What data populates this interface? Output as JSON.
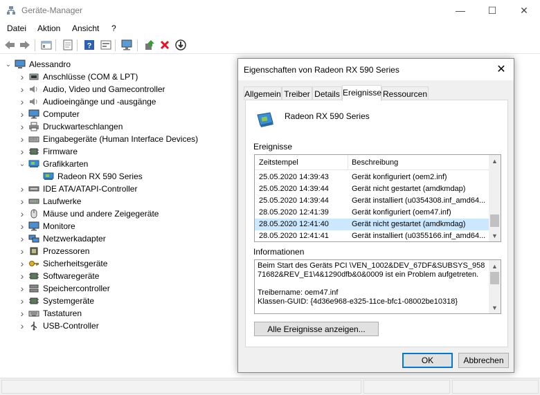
{
  "window": {
    "title": "Geräte-Manager",
    "minimize": "—",
    "maximize": "☐",
    "close": "✕"
  },
  "menu": [
    "Datei",
    "Aktion",
    "Ansicht",
    "?"
  ],
  "tree": {
    "root": "Alessandro",
    "items": [
      {
        "label": "Anschlüsse (COM & LPT)",
        "icon": "port-icon"
      },
      {
        "label": "Audio, Video und Gamecontroller",
        "icon": "speaker-icon"
      },
      {
        "label": "Audioeingänge und -ausgänge",
        "icon": "speaker-icon"
      },
      {
        "label": "Computer",
        "icon": "monitor-icon"
      },
      {
        "label": "Druckwarteschlangen",
        "icon": "printer-icon"
      },
      {
        "label": "Eingabegeräte (Human Interface Devices)",
        "icon": "hid-icon"
      },
      {
        "label": "Firmware",
        "icon": "chip-icon"
      },
      {
        "label": "Grafikkarten",
        "icon": "display-adapter-icon",
        "expanded": true
      },
      {
        "label": "Radeon RX 590 Series",
        "icon": "display-adapter-icon",
        "child": true
      },
      {
        "label": "IDE ATA/ATAPI-Controller",
        "icon": "ide-icon"
      },
      {
        "label": "Laufwerke",
        "icon": "drive-icon"
      },
      {
        "label": "Mäuse und andere Zeigegeräte",
        "icon": "mouse-icon"
      },
      {
        "label": "Monitore",
        "icon": "monitor-icon"
      },
      {
        "label": "Netzwerkadapter",
        "icon": "network-icon"
      },
      {
        "label": "Prozessoren",
        "icon": "cpu-icon"
      },
      {
        "label": "Sicherheitsgeräte",
        "icon": "key-icon"
      },
      {
        "label": "Softwaregeräte",
        "icon": "chip-icon"
      },
      {
        "label": "Speichercontroller",
        "icon": "storage-icon"
      },
      {
        "label": "Systemgeräte",
        "icon": "chip-icon"
      },
      {
        "label": "Tastaturen",
        "icon": "keyboard-icon"
      },
      {
        "label": "USB-Controller",
        "icon": "usb-icon"
      }
    ]
  },
  "dialog": {
    "title": "Eigenschaften von Radeon RX 590 Series",
    "tabs": [
      "Allgemein",
      "Treiber",
      "Details",
      "Ereignisse",
      "Ressourcen"
    ],
    "active_tab": "Ereignisse",
    "device_name": "Radeon RX 590 Series",
    "events_label": "Ereignisse",
    "columns": [
      "Zeitstempel",
      "Beschreibung"
    ],
    "events": [
      [
        "25.05.2020 14:39:43",
        "Gerät konfiguriert (oem2.inf)"
      ],
      [
        "25.05.2020 14:39:44",
        "Gerät nicht gestartet (amdkmdap)"
      ],
      [
        "25.05.2020 14:39:44",
        "Gerät installiert (u0354308.inf_amd64..."
      ],
      [
        "28.05.2020 12:41:39",
        "Gerät konfiguriert (oem47.inf)"
      ],
      [
        "28.05.2020 12:41:40",
        "Gerät nicht gestartet (amdkmdag)"
      ],
      [
        "28.05.2020 12:41:41",
        "Gerät installiert (u0355166.inf_amd64..."
      ]
    ],
    "selected_index": 4,
    "info_label": "Informationen",
    "info_text": "Beim Start des Geräts PCI \\VEN_1002&DEV_67DF&SUBSYS_95871682&REV_E1\\4&1290dfb&0&0009 ist ein Problem aufgetreten.\n\nTreibername: oem47.inf\nKlassen-GUID: {4d36e968-e325-11ce-bfc1-08002be10318}",
    "show_all_button": "Alle Ereignisse anzeigen...",
    "ok_button": "OK",
    "cancel_button": "Abbrechen",
    "close": "✕"
  },
  "colors": {
    "selection": "#cce8ff",
    "accent": "#0078d7",
    "delete_red": "#e81123"
  }
}
